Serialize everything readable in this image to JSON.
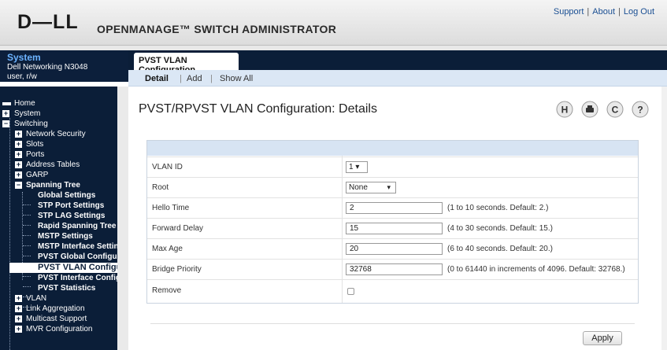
{
  "header": {
    "logo": "D—LL",
    "title": "OPENMANAGE™ SWITCH ADMINISTRATOR",
    "links": [
      "Support",
      "About",
      "Log Out"
    ]
  },
  "system": {
    "title": "System",
    "model": "Dell Networking N3048",
    "user": "user, r/w"
  },
  "nav": {
    "items": [
      {
        "label": "Home"
      },
      {
        "label": "System"
      },
      {
        "label": "Switching"
      },
      {
        "label": "Network Security"
      },
      {
        "label": "Slots"
      },
      {
        "label": "Ports"
      },
      {
        "label": "Address Tables"
      },
      {
        "label": "GARP"
      },
      {
        "label": "Spanning Tree"
      },
      {
        "label": "Global Settings"
      },
      {
        "label": "STP Port Settings"
      },
      {
        "label": "STP LAG Settings"
      },
      {
        "label": "Rapid Spanning Tree"
      },
      {
        "label": "MSTP Settings"
      },
      {
        "label": "MSTP Interface Settings"
      },
      {
        "label": "PVST Global Configuration"
      },
      {
        "label": "PVST VLAN Configuration"
      },
      {
        "label": "PVST Interface Configuration"
      },
      {
        "label": "PVST Statistics"
      },
      {
        "label": "VLAN"
      },
      {
        "label": "Link Aggregation"
      },
      {
        "label": "Multicast Support"
      },
      {
        "label": "MVR Configuration"
      }
    ]
  },
  "tabs": {
    "main": "PVST VLAN Configuration",
    "sub": [
      "Detail",
      "Add",
      "Show All"
    ]
  },
  "page": {
    "title": "PVST/RPVST VLAN Configuration: Details",
    "icons": [
      "help-h-icon",
      "print-icon",
      "refresh-icon",
      "question-icon"
    ]
  },
  "form": {
    "rows": [
      {
        "label": "VLAN ID",
        "value": "1 ▾"
      },
      {
        "label": "Root",
        "value": "None"
      },
      {
        "label": "Hello Time",
        "value": "2",
        "hint": "(1 to 10 seconds. Default: 2.)"
      },
      {
        "label": "Forward Delay",
        "value": "15",
        "hint": "(4 to 30 seconds. Default: 15.)"
      },
      {
        "label": "Max Age",
        "value": "20",
        "hint": "(6 to 40 seconds. Default: 20.)"
      },
      {
        "label": "Bridge Priority",
        "value": "32768",
        "hint": "(0 to 61440 in increments of 4096. Default: 32768.)"
      },
      {
        "label": "Remove",
        "value": ""
      }
    ],
    "apply_label": "Apply"
  },
  "colors": {
    "nav_bg": "#0b1e38",
    "accent": "#6cb3ff",
    "subtab_bg": "#dbe7f5"
  }
}
